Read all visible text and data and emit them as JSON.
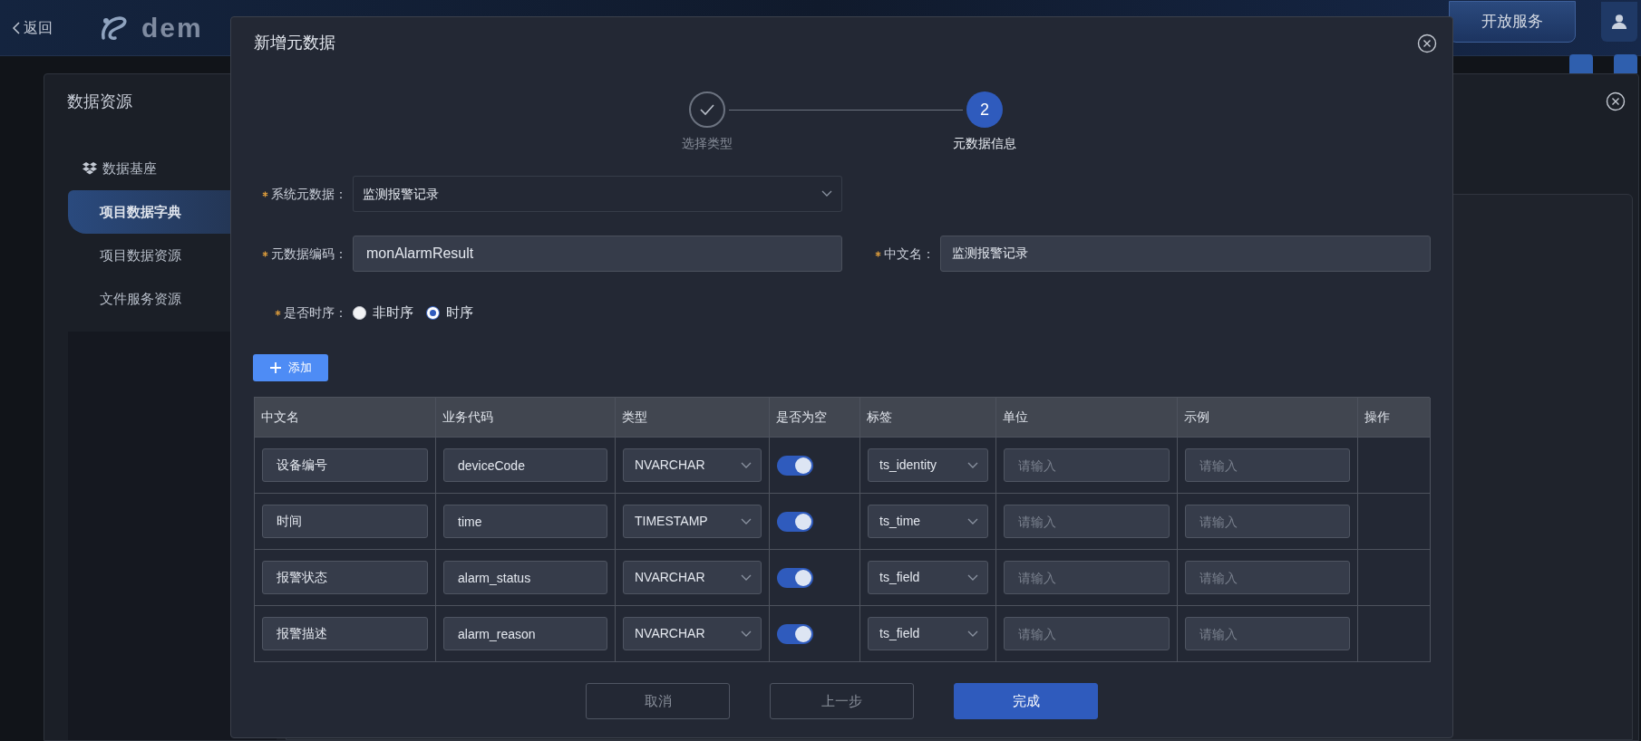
{
  "header": {
    "back": "返回",
    "brand": "dem",
    "nav_tab": "开放服务"
  },
  "panel": {
    "title": "数据资源",
    "sidebar": [
      {
        "label": "数据基座",
        "selected": false,
        "children": [
          {
            "label": "项目数据字典",
            "selected": true
          },
          {
            "label": "项目数据资源",
            "selected": false
          },
          {
            "label": "文件服务资源",
            "selected": false
          }
        ]
      }
    ]
  },
  "modal": {
    "title": "新增元数据",
    "steps": [
      {
        "label": "选择类型",
        "done": true,
        "selected": false
      },
      {
        "label": "元数据信息",
        "number": "2",
        "done": false,
        "selected": true
      }
    ],
    "system_metadata": {
      "label": "系统元数据：",
      "value": "监测报警记录",
      "required": true
    },
    "metadata_code": {
      "label": "元数据编码：",
      "value": "monAlarmResult",
      "required": true
    },
    "chinese_name": {
      "label": "中文名：",
      "value": "监测报警记录",
      "required": true
    },
    "time_series": {
      "label": "是否时序：",
      "required": true,
      "options": [
        {
          "label": "非时序",
          "selected": false
        },
        {
          "label": "时序",
          "selected": true
        }
      ]
    },
    "add_button": "添加",
    "table": {
      "columns": [
        "中文名",
        "业务代码",
        "类型",
        "是否为空",
        "标签",
        "单位",
        "示例",
        "操作"
      ],
      "rows": [
        {
          "name": "设备编号",
          "code": "deviceCode",
          "type": "NVARCHAR",
          "nullable": true,
          "tag": "ts_identity",
          "unit_placeholder": "请输入",
          "example_placeholder": "请输入"
        },
        {
          "name": "时间",
          "code": "time",
          "type": "TIMESTAMP",
          "nullable": true,
          "tag": "ts_time",
          "unit_placeholder": "请输入",
          "example_placeholder": "请输入"
        },
        {
          "name": "报警状态",
          "code": "alarm_status",
          "type": "NVARCHAR",
          "nullable": true,
          "tag": "ts_field",
          "unit_placeholder": "请输入",
          "example_placeholder": "请输入"
        },
        {
          "name": "报警描述",
          "code": "alarm_reason",
          "type": "NVARCHAR",
          "nullable": true,
          "tag": "ts_field",
          "unit_placeholder": "请输入",
          "example_placeholder": "请输入"
        }
      ]
    },
    "buttons": [
      {
        "label": "取消",
        "kind": "secondary"
      },
      {
        "label": "上一步",
        "kind": "secondary"
      },
      {
        "label": "完成",
        "kind": "primary"
      }
    ]
  }
}
